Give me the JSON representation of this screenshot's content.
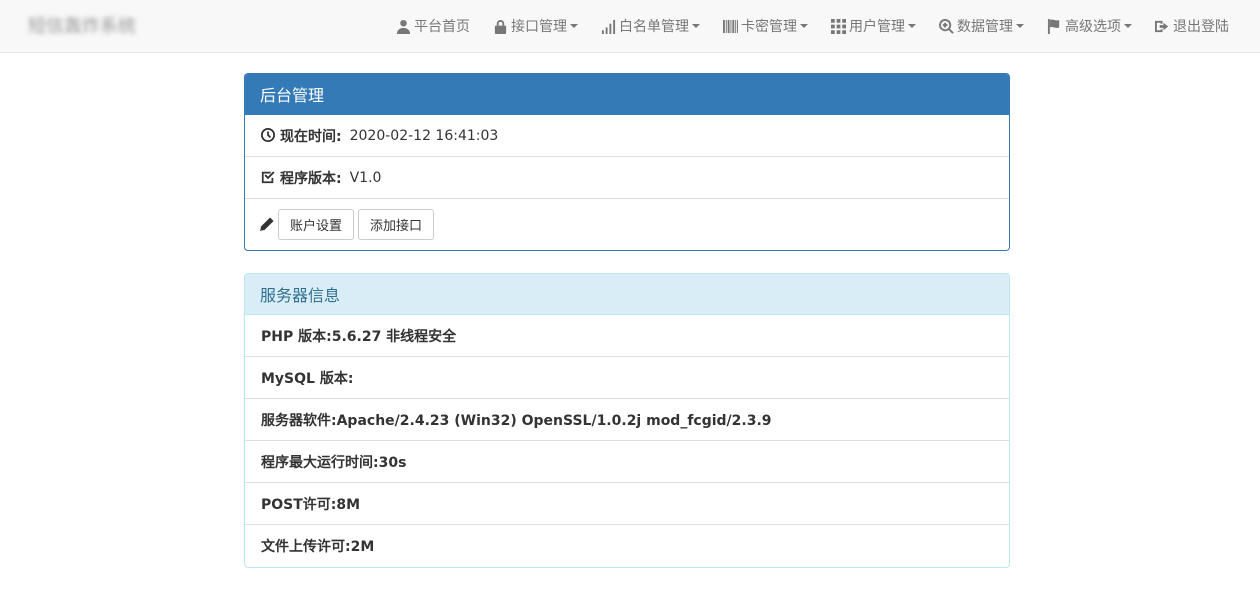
{
  "brand": {
    "title": "短信轰炸系统"
  },
  "nav": {
    "items": [
      {
        "label": "平台首页",
        "icon": "user-icon",
        "dropdown": false
      },
      {
        "label": "接口管理",
        "icon": "lock-icon",
        "dropdown": true
      },
      {
        "label": "白名单管理",
        "icon": "signal-icon",
        "dropdown": true
      },
      {
        "label": "卡密管理",
        "icon": "barcode-icon",
        "dropdown": true
      },
      {
        "label": "用户管理",
        "icon": "grid-icon",
        "dropdown": true
      },
      {
        "label": "数据管理",
        "icon": "zoom-in-icon",
        "dropdown": true
      },
      {
        "label": "高级选项",
        "icon": "flag-icon",
        "dropdown": true
      },
      {
        "label": "退出登陆",
        "icon": "log-out-icon",
        "dropdown": false
      }
    ]
  },
  "admin_panel": {
    "title": "后台管理",
    "time_label": "现在时间:",
    "time_value": "2020-02-12 16:41:03",
    "version_label": "程序版本:",
    "version_value": "V1.0",
    "account_button": "账户设置",
    "add_api_button": "添加接口"
  },
  "server_panel": {
    "title": "服务器信息",
    "php": "PHP 版本:5.6.27 非线程安全",
    "mysql": "MySQL 版本:",
    "software": "服务器软件:Apache/2.4.23 (Win32) OpenSSL/1.0.2j mod_fcgid/2.3.9",
    "max_exec": "程序最大运行时间:30s",
    "post": "POST许可:8M",
    "upload": "文件上传许可:2M"
  },
  "colors": {
    "primary": "#337ab7",
    "info_bg": "#d9edf7",
    "info_text": "#31708f"
  }
}
